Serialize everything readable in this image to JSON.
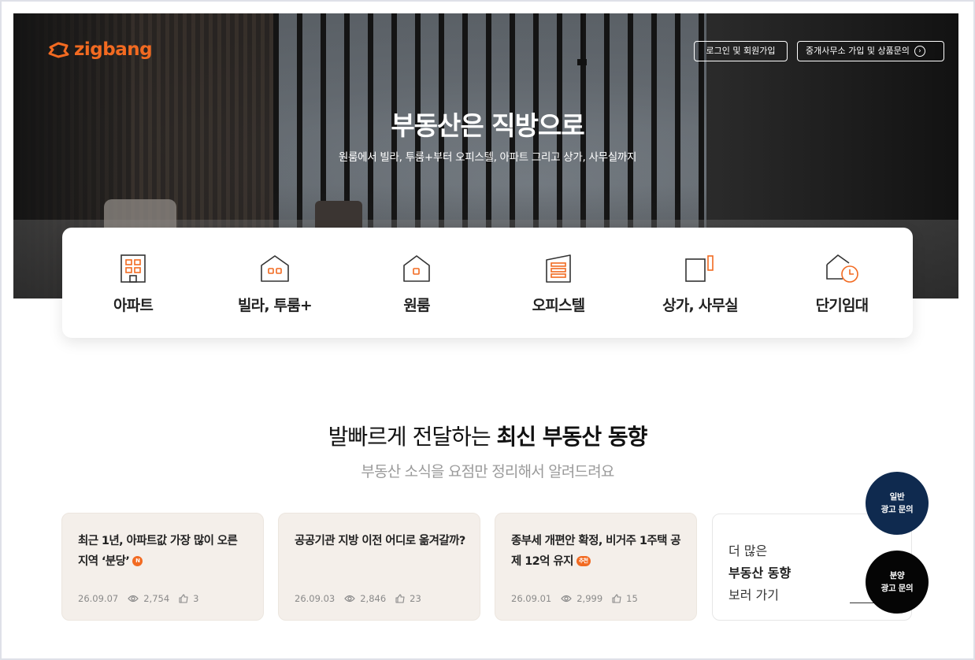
{
  "brand": {
    "name": "zigbang",
    "accent": "#f26a21",
    "icon": "zigbang-logo-icon"
  },
  "header": {
    "login_label": "로그인 및 회원가입",
    "agent_label": "중개사무소 가입 및 상품문의",
    "agent_icon": "chevron-right-circle-icon"
  },
  "hero": {
    "title": "부동산은 직방으로",
    "subtitle": "원룸에서 빌라, 투룸+부터 오피스텔, 아파트 그리고 상가, 사무실까지"
  },
  "categories": [
    {
      "label": "아파트",
      "icon": "apartment-icon"
    },
    {
      "label": "빌라, 투룸+",
      "icon": "villa-icon"
    },
    {
      "label": "원룸",
      "icon": "oneroom-icon"
    },
    {
      "label": "오피스텔",
      "icon": "officetel-icon"
    },
    {
      "label": "상가, 사무실",
      "icon": "store-office-icon"
    },
    {
      "label": "단기임대",
      "icon": "short-rent-icon"
    }
  ],
  "news": {
    "title_plain": "발빠르게 전달하는 ",
    "title_bold": "최신 부동산 동향",
    "subtitle": "부동산 소식을 요점만 정리해서 알려드려요",
    "items": [
      {
        "headline": "최근 1년, 아파트값 가장 많이 오른 지역 ‘분당’",
        "badge": "N",
        "date": "26.09.07",
        "views": "2,754",
        "likes": "3"
      },
      {
        "headline": "공공기관 지방 이전 어디로 옮겨갈까?",
        "badge": "",
        "date": "26.09.03",
        "views": "2,846",
        "likes": "23"
      },
      {
        "headline": "종부세 개편안 확정, 비거주 1주택 공제 12억 유지",
        "badge": "추천",
        "date": "26.09.01",
        "views": "2,999",
        "likes": "15"
      }
    ],
    "more": {
      "line1": "더 많은",
      "line2": "부동산 동향",
      "line3": "보러 가기"
    }
  },
  "floating": {
    "general": {
      "line1": "일반",
      "line2": "광고 문의",
      "color": "#0f2a4f"
    },
    "presale": {
      "line1": "분양",
      "line2": "광고 문의",
      "color": "#050505"
    }
  }
}
